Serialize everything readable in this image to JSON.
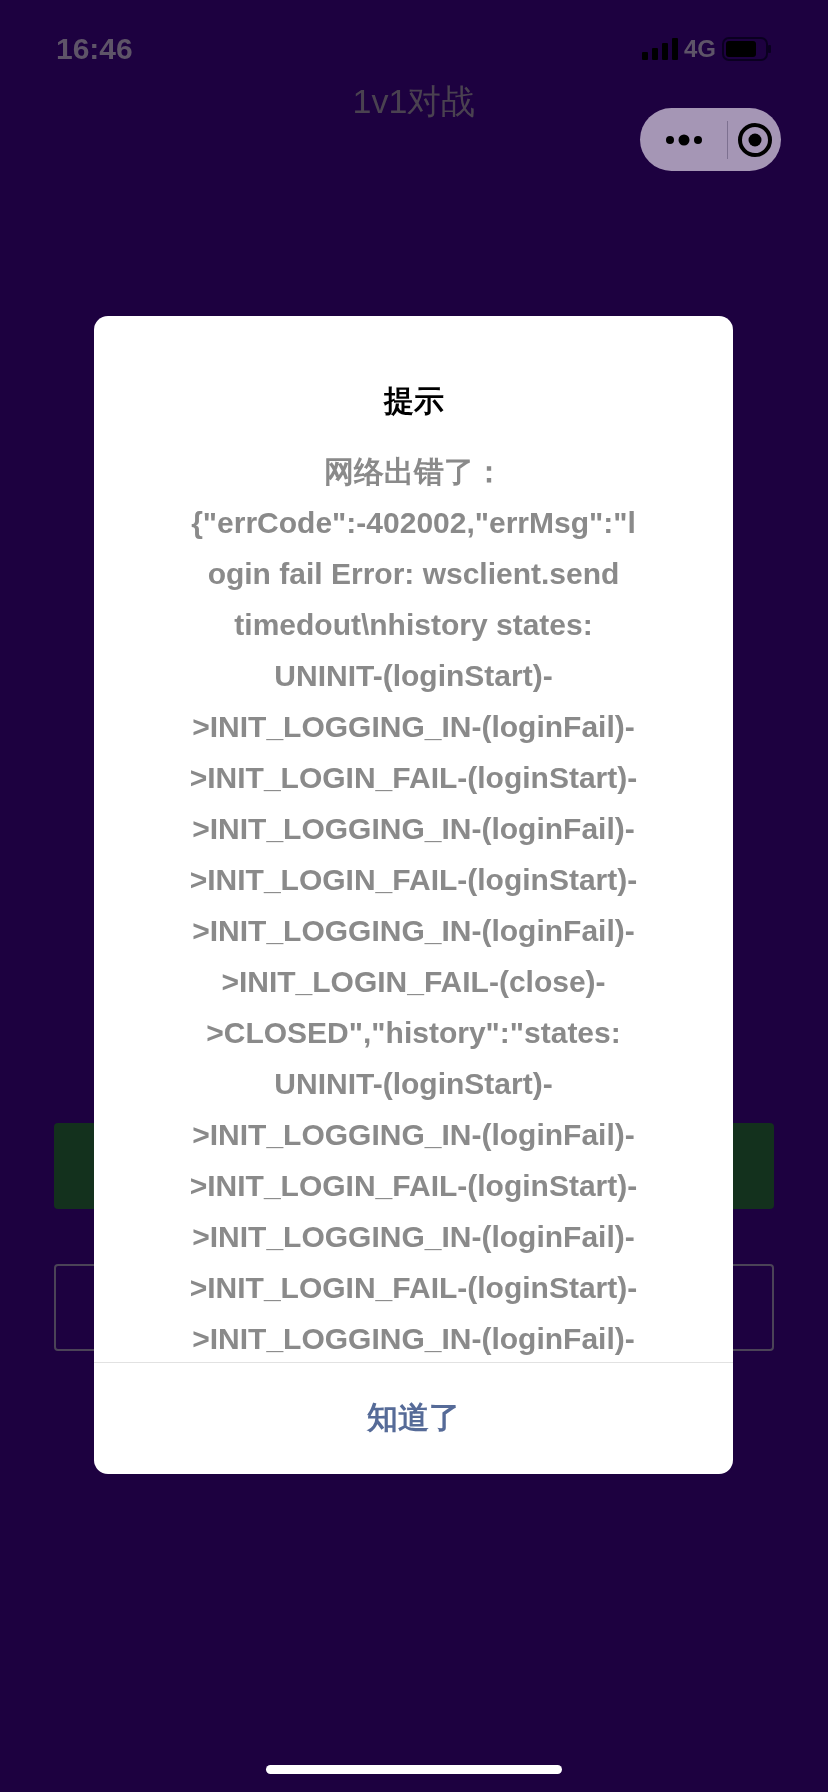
{
  "status_bar": {
    "time": "16:46",
    "network": "4G"
  },
  "nav": {
    "title": "1v1对战"
  },
  "background_buttons": [
    {
      "kind": "filled"
    },
    {
      "kind": "outlined"
    }
  ],
  "dialog": {
    "title": "提示",
    "message_lines": [
      "网络出错了：",
      "{\"errCode\":-402002,\"errMsg\":\"l",
      "ogin fail Error: wsclient.send",
      "timedout\\nhistory states:",
      "UNINIT-(loginStart)-",
      ">INIT_LOGGING_IN-(loginFail)-",
      ">INIT_LOGIN_FAIL-(loginStart)-",
      ">INIT_LOGGING_IN-(loginFail)-",
      ">INIT_LOGIN_FAIL-(loginStart)-",
      ">INIT_LOGGING_IN-(loginFail)-",
      ">INIT_LOGIN_FAIL-(close)-",
      ">CLOSED\",\"history\":\"states:",
      "UNINIT-(loginStart)-",
      ">INIT_LOGGING_IN-(loginFail)-",
      ">INIT_LOGIN_FAIL-(loginStart)-",
      ">INIT_LOGGING_IN-(loginFail)-",
      ">INIT_LOGIN_FAIL-(loginStart)-",
      ">INIT_LOGGING_IN-(loginFail)-"
    ],
    "confirm": "知道了"
  }
}
